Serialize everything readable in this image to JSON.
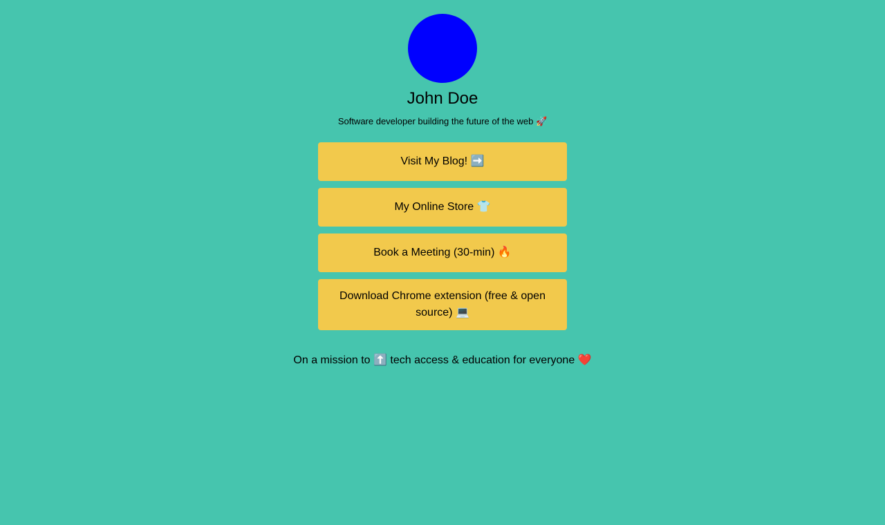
{
  "profile": {
    "avatar_color": "#0000ff",
    "name": "John Doe",
    "bio": "Software developer building the future of the web 🚀"
  },
  "links": [
    {
      "label": "Visit My Blog! ➡️"
    },
    {
      "label": "My Online Store 👕"
    },
    {
      "label": "Book a Meeting (30-min) 🔥"
    },
    {
      "label": "Download Chrome extension (free & open source) 💻"
    }
  ],
  "footer": {
    "mission": "On a mission to ⬆️ tech access & education for everyone ❤️"
  },
  "colors": {
    "background": "#46c5ae",
    "button": "#f2c94c"
  }
}
